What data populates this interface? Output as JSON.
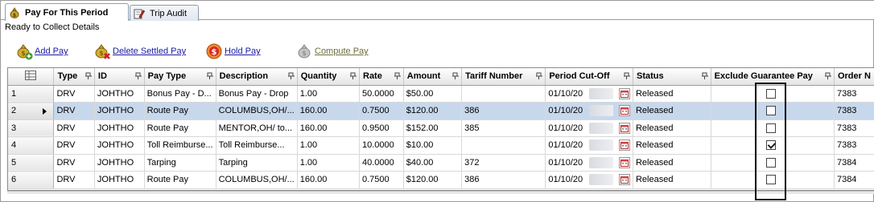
{
  "tabs": [
    {
      "label": "Pay For This Period",
      "icon": "money-bag-icon",
      "active": true
    },
    {
      "label": "Trip Audit",
      "icon": "audit-edit-icon",
      "active": false
    }
  ],
  "subtitle": "Ready to Collect Details",
  "toolbar": {
    "add_pay": "Add Pay",
    "delete_settled_pay": "Delete Settled Pay",
    "hold_pay": "Hold Pay",
    "compute_pay": "Compute Pay"
  },
  "grid": {
    "columns": [
      "Type",
      "ID",
      "Pay Type",
      "Description",
      "Quantity",
      "Rate",
      "Amount",
      "Tariff Number",
      "Period Cut-Off",
      "Status",
      "Exclude Guarantee Pay",
      "Order N"
    ],
    "rows": [
      {
        "num": "1",
        "type": "DRV",
        "id": "JOHTHO",
        "pay_type": "Bonus Pay - D...",
        "description": "Bonus Pay - Drop",
        "quantity": "1.00",
        "rate": "50.0000",
        "amount": "$50.00",
        "tariff": "",
        "period": "01/10/20",
        "status": "Released",
        "exclude": false,
        "order": "7383"
      },
      {
        "num": "2",
        "type": "DRV",
        "id": "JOHTHO",
        "pay_type": "Route Pay",
        "description": "COLUMBUS,OH/...",
        "quantity": "160.00",
        "rate": "0.7500",
        "amount": "$120.00",
        "tariff": "386",
        "period": "01/10/20",
        "status": "Released",
        "exclude": false,
        "order": "7383"
      },
      {
        "num": "3",
        "type": "DRV",
        "id": "JOHTHO",
        "pay_type": "Route Pay",
        "description": "MENTOR,OH/ to...",
        "quantity": "160.00",
        "rate": "0.9500",
        "amount": "$152.00",
        "tariff": "385",
        "period": "01/10/20",
        "status": "Released",
        "exclude": false,
        "order": "7383"
      },
      {
        "num": "4",
        "type": "DRV",
        "id": "JOHTHO",
        "pay_type": "Toll Reimburse...",
        "description": "Toll Reimburse...",
        "quantity": "1.00",
        "rate": "10.0000",
        "amount": "$10.00",
        "tariff": "",
        "period": "01/10/20",
        "status": "Released",
        "exclude": true,
        "order": "7383"
      },
      {
        "num": "5",
        "type": "DRV",
        "id": "JOHTHO",
        "pay_type": "Tarping",
        "description": "Tarping",
        "quantity": "1.00",
        "rate": "40.0000",
        "amount": "$40.00",
        "tariff": "372",
        "period": "01/10/20",
        "status": "Released",
        "exclude": false,
        "order": "7384"
      },
      {
        "num": "6",
        "type": "DRV",
        "id": "JOHTHO",
        "pay_type": "Route Pay",
        "description": "COLUMBUS,OH/...",
        "quantity": "160.00",
        "rate": "0.7500",
        "amount": "$120.00",
        "tariff": "386",
        "period": "01/10/20",
        "status": "Released",
        "exclude": false,
        "order": "7384"
      }
    ],
    "selected_row": 1
  },
  "colors": {
    "selected_row": "#c8d8ec",
    "link": "#1a1aa6",
    "header_border": "#9c9c9c"
  }
}
